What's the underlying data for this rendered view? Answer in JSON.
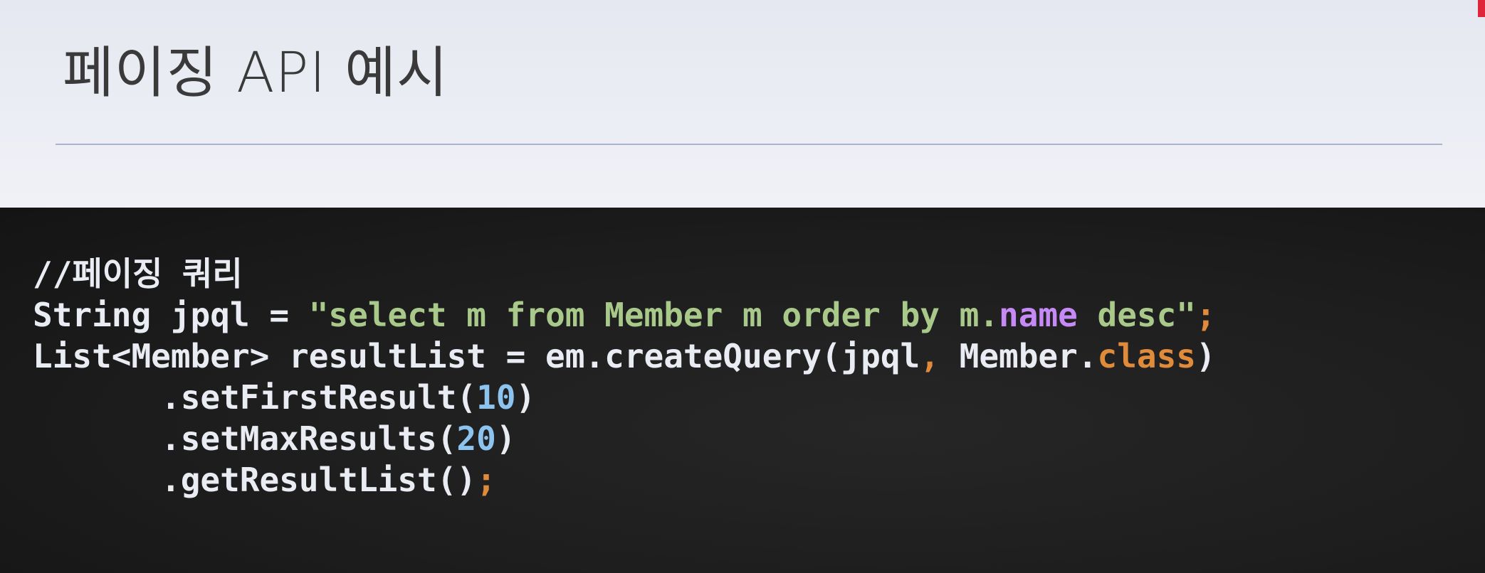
{
  "slide": {
    "title": "페이징 API 예시"
  },
  "code": {
    "comment": "//페이징 쿼리",
    "line2": {
      "p1": "String jpql = ",
      "str1": "\"select m from Member m order by m.",
      "field": "name",
      "str2": " desc\"",
      "semi": ";"
    },
    "line3": {
      "p1": "List<Member> resultList = em.createQuery(jpql",
      "comma": ",",
      "p2": " Member.",
      "kw": "class",
      "p3": ")"
    },
    "line4": {
      "p1": ".setFirstResult(",
      "num": "10",
      "p2": ")"
    },
    "line5": {
      "p1": ".setMaxResults(",
      "num": "20",
      "p2": ")"
    },
    "line6": {
      "p1": ".getResultList()",
      "semi": ";"
    }
  },
  "colors": {
    "header_bg": "#eceef5",
    "title_text": "#3a3a3a",
    "divider": "#a9b3cc",
    "code_bg": "#1d1d1d",
    "code_text": "#e9ecf2",
    "string": "#a8c98a",
    "field": "#c58af6",
    "keyword": "#e08a3c",
    "number": "#8cc4ef",
    "accent_red": "#e0253a"
  }
}
